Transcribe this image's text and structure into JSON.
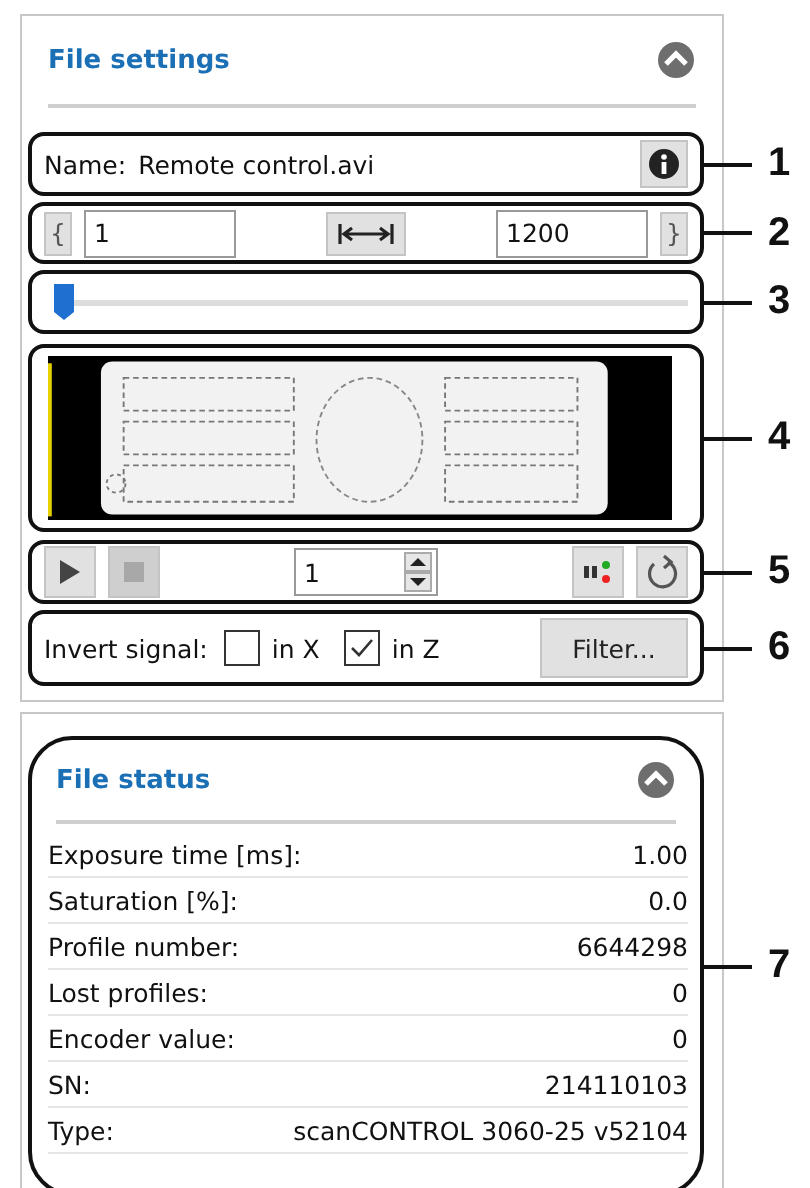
{
  "file_settings": {
    "title": "File settings",
    "expanded": true,
    "name_row": {
      "callout": "1",
      "label": "Name:",
      "value": "Remote control.avi"
    },
    "range_row": {
      "callout": "2",
      "prev": "{",
      "start": "1",
      "end": "1200",
      "next": "}"
    },
    "slider_row": {
      "callout": "3",
      "level": 0.0
    },
    "preview_row": {
      "callout": "4",
      "kind": "picture"
    },
    "playback_row": {
      "callout": "5",
      "play_disabled": false,
      "stop_disabled": true,
      "frame": "1"
    },
    "invert_row": {
      "callout": "6",
      "label": "Invert signal:",
      "options": [
        {
          "label": "in X",
          "checked": false
        },
        {
          "label": "in Z",
          "checked": true
        }
      ],
      "filter_button": "Filter..."
    }
  },
  "file_status": {
    "title": "File status",
    "expanded": true,
    "callout": "7",
    "rows": [
      {
        "label": "Exposure time [ms]:",
        "value": "1.00"
      },
      {
        "label": "Saturation [%]:",
        "value": "0.0"
      },
      {
        "label": "Profile number:",
        "value": "6644298"
      },
      {
        "label": "Lost profiles:",
        "value": "0"
      },
      {
        "label": "Encoder value:",
        "value": "0"
      },
      {
        "label": "SN:",
        "value": "214110103"
      },
      {
        "label": "Type:",
        "value": "scanCONTROL 3060-25 v52104"
      }
    ]
  }
}
